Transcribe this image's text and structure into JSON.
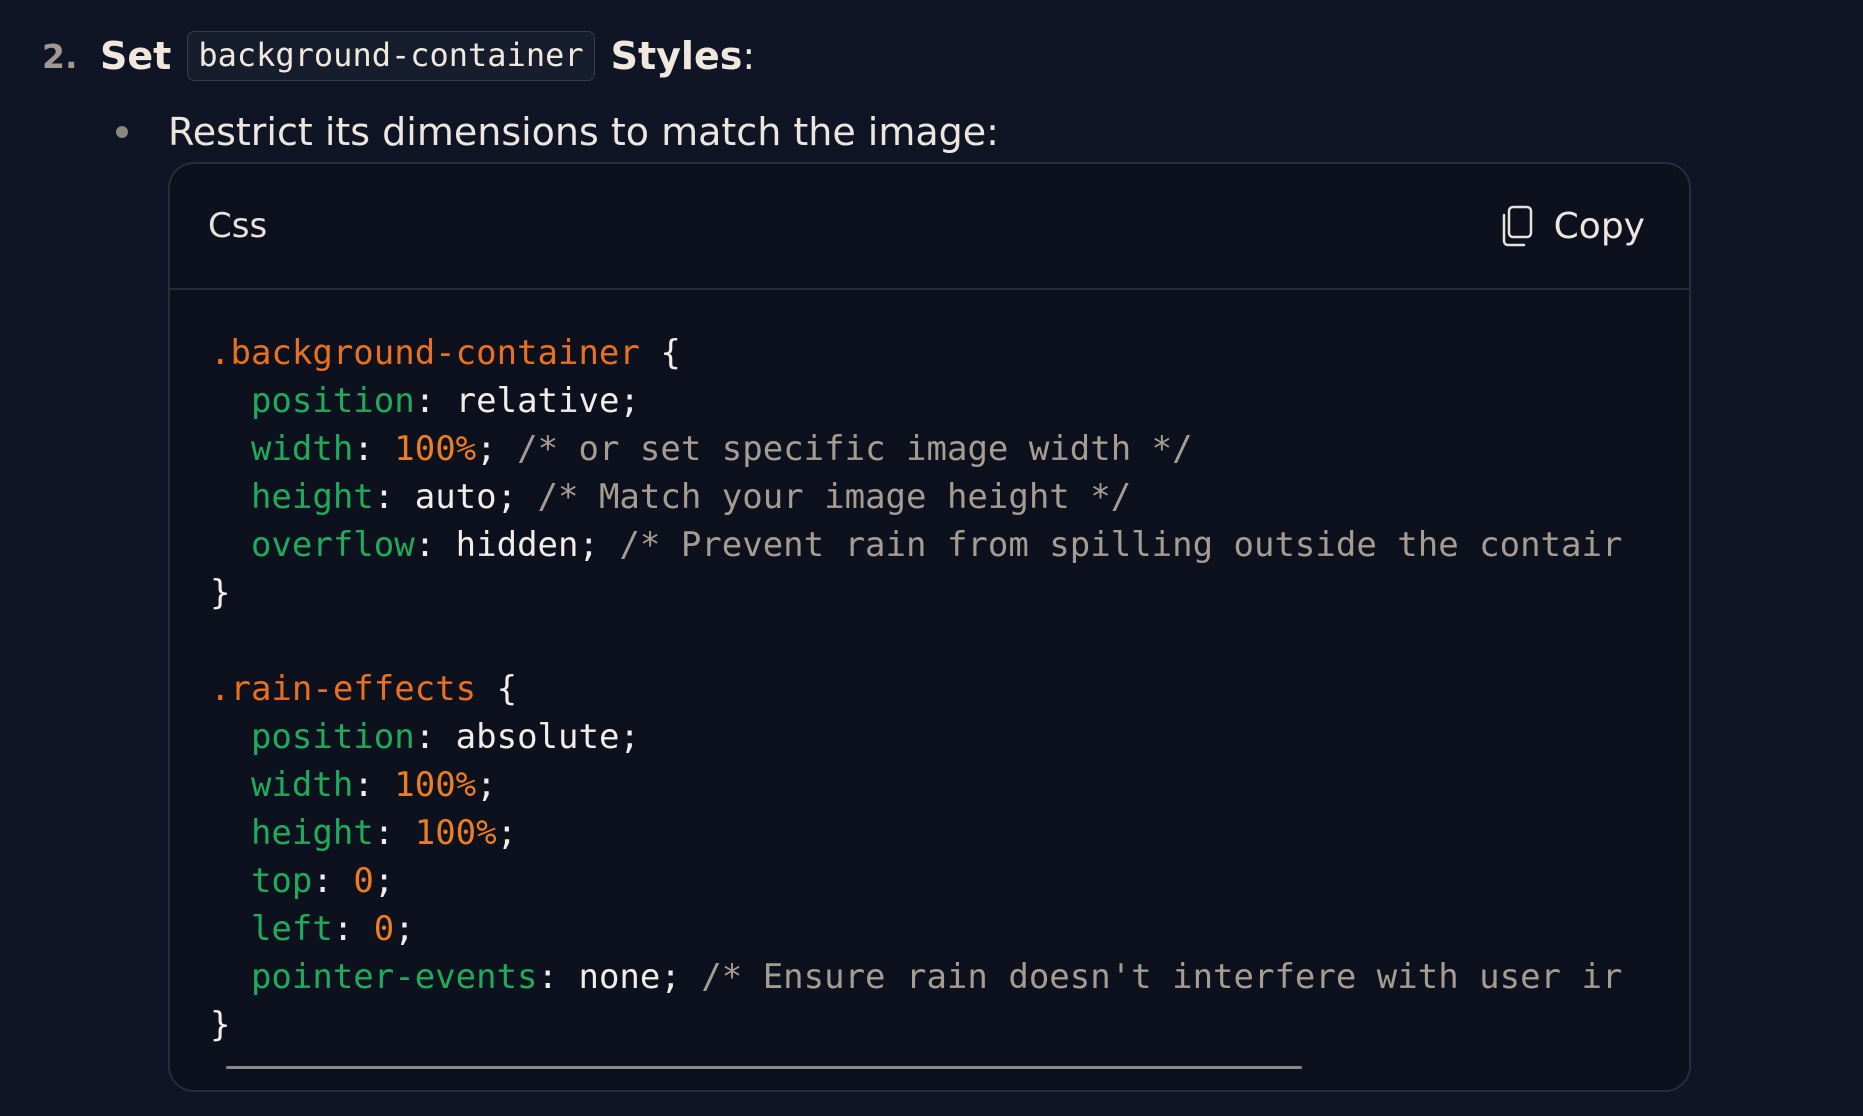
{
  "step": {
    "number": "2.",
    "title_before": "Set",
    "inline_code": "background-container",
    "title_after": "Styles",
    "title_colon": ":"
  },
  "bullet": {
    "text": "Restrict its dimensions to match the image:"
  },
  "code_block": {
    "language": "Css",
    "copy_label": "Copy",
    "copy_icon": "copy-icon",
    "scrollbar_position": 0,
    "scrollbar_visible_fraction": 0.765,
    "lines": [
      [
        {
          "t": ".background-container",
          "c": "sel"
        },
        {
          "t": " {",
          "c": "plain"
        }
      ],
      [
        {
          "t": "  ",
          "c": "plain"
        },
        {
          "t": "position",
          "c": "prop"
        },
        {
          "t": ": relative;",
          "c": "plain"
        }
      ],
      [
        {
          "t": "  ",
          "c": "plain"
        },
        {
          "t": "width",
          "c": "prop"
        },
        {
          "t": ": ",
          "c": "plain"
        },
        {
          "t": "100%",
          "c": "num"
        },
        {
          "t": "; ",
          "c": "plain"
        },
        {
          "t": "/* or set specific image width */",
          "c": "cmt"
        }
      ],
      [
        {
          "t": "  ",
          "c": "plain"
        },
        {
          "t": "height",
          "c": "prop"
        },
        {
          "t": ": auto; ",
          "c": "plain"
        },
        {
          "t": "/* Match your image height */",
          "c": "cmt"
        }
      ],
      [
        {
          "t": "  ",
          "c": "plain"
        },
        {
          "t": "overflow",
          "c": "prop"
        },
        {
          "t": ": hidden; ",
          "c": "plain"
        },
        {
          "t": "/* Prevent rain from spilling outside the contair",
          "c": "cmt"
        }
      ],
      [
        {
          "t": "}",
          "c": "plain"
        }
      ],
      [
        {
          "t": "",
          "c": "plain"
        }
      ],
      [
        {
          "t": ".rain-effects",
          "c": "sel"
        },
        {
          "t": " {",
          "c": "plain"
        }
      ],
      [
        {
          "t": "  ",
          "c": "plain"
        },
        {
          "t": "position",
          "c": "prop"
        },
        {
          "t": ": absolute;",
          "c": "plain"
        }
      ],
      [
        {
          "t": "  ",
          "c": "plain"
        },
        {
          "t": "width",
          "c": "prop"
        },
        {
          "t": ": ",
          "c": "plain"
        },
        {
          "t": "100%",
          "c": "num"
        },
        {
          "t": ";",
          "c": "plain"
        }
      ],
      [
        {
          "t": "  ",
          "c": "plain"
        },
        {
          "t": "height",
          "c": "prop"
        },
        {
          "t": ": ",
          "c": "plain"
        },
        {
          "t": "100%",
          "c": "num"
        },
        {
          "t": ";",
          "c": "plain"
        }
      ],
      [
        {
          "t": "  ",
          "c": "plain"
        },
        {
          "t": "top",
          "c": "prop"
        },
        {
          "t": ": ",
          "c": "plain"
        },
        {
          "t": "0",
          "c": "num"
        },
        {
          "t": ";",
          "c": "plain"
        }
      ],
      [
        {
          "t": "  ",
          "c": "plain"
        },
        {
          "t": "left",
          "c": "prop"
        },
        {
          "t": ": ",
          "c": "plain"
        },
        {
          "t": "0",
          "c": "num"
        },
        {
          "t": ";",
          "c": "plain"
        }
      ],
      [
        {
          "t": "  ",
          "c": "plain"
        },
        {
          "t": "pointer-events",
          "c": "prop"
        },
        {
          "t": ": none; ",
          "c": "plain"
        },
        {
          "t": "/* Ensure rain doesn't interfere with user ir",
          "c": "cmt"
        }
      ],
      [
        {
          "t": "}",
          "c": "plain"
        }
      ]
    ]
  }
}
